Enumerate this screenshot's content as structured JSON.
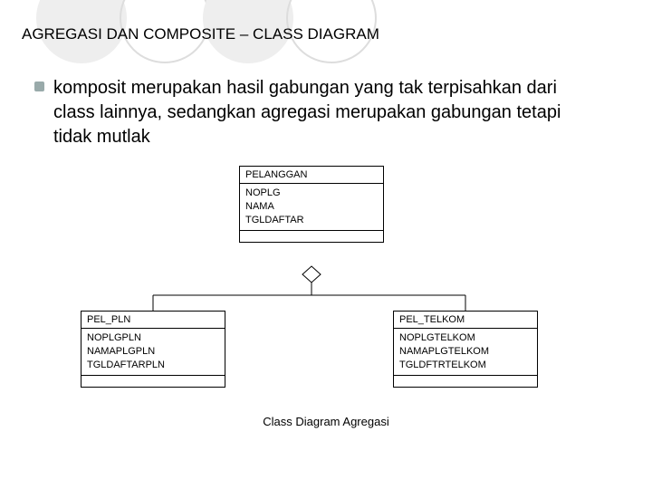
{
  "title": "AGREGASI DAN COMPOSITE – CLASS DIAGRAM",
  "bullet": "komposit merupakan hasil gabungan yang tak terpisahkan dari class lainnya, sedangkan agregasi merupakan gabungan tetapi tidak mutlak",
  "classes": {
    "parent": {
      "name": "PELANGGAN",
      "attrs": [
        "NOPLG",
        "NAMA",
        "TGLDAFTAR"
      ]
    },
    "left": {
      "name": "PEL_PLN",
      "attrs": [
        "NOPLGPLN",
        "NAMAPLGPLN",
        "TGLDAFTARPLN"
      ]
    },
    "right": {
      "name": "PEL_TELKOM",
      "attrs": [
        "NOPLGTELKOM",
        "NAMAPLGTELKOM",
        "TGLDFTRTELKOM"
      ]
    }
  },
  "caption": "Class Diagram Agregasi",
  "chart_data": {
    "type": "table",
    "description": "UML class diagram showing aggregation",
    "parent_class": "PELANGGAN",
    "child_classes": [
      "PEL_PLN",
      "PEL_TELKOM"
    ],
    "relationship": "aggregation",
    "classes": [
      {
        "name": "PELANGGAN",
        "attributes": [
          "NOPLG",
          "NAMA",
          "TGLDAFTAR"
        ],
        "operations": []
      },
      {
        "name": "PEL_PLN",
        "attributes": [
          "NOPLGPLN",
          "NAMAPLGPLN",
          "TGLDAFTARPLN"
        ],
        "operations": []
      },
      {
        "name": "PEL_TELKOM",
        "attributes": [
          "NOPLGTELKOM",
          "NAMAPLGTELKOM",
          "TGLDFTRTELKOM"
        ],
        "operations": []
      }
    ]
  }
}
